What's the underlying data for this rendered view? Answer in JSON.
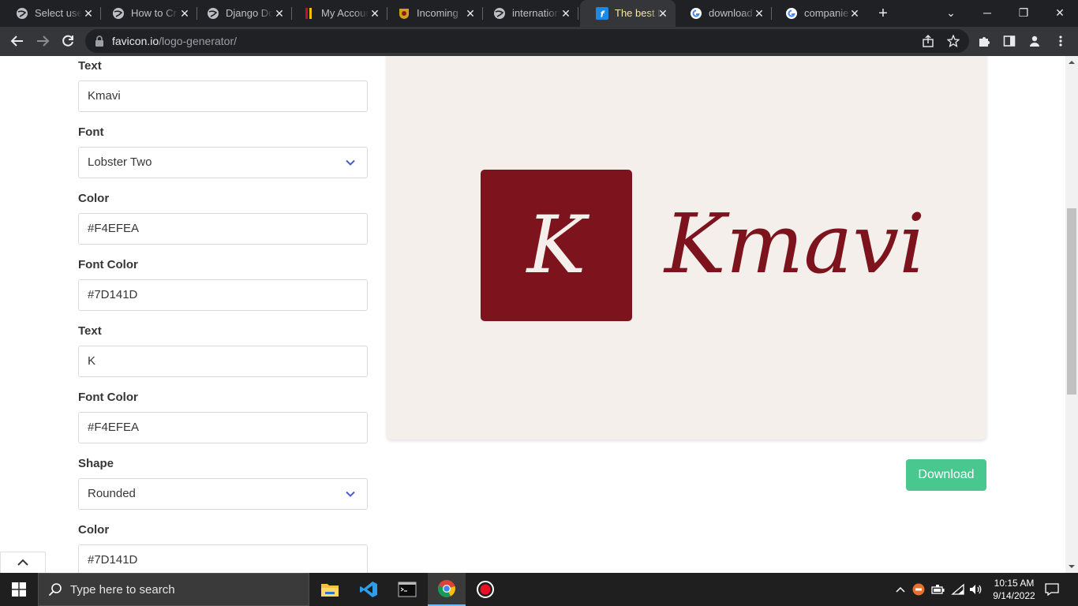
{
  "browser": {
    "tabs": [
      {
        "title": "Select user",
        "icon": "globe-icon"
      },
      {
        "title": "How to Cr",
        "icon": "globe-icon"
      },
      {
        "title": "Django Do",
        "icon": "globe-icon"
      },
      {
        "title": "My Accoun",
        "icon": "bank-icon"
      },
      {
        "title": "Incoming",
        "icon": "crest-icon"
      },
      {
        "title": "internation",
        "icon": "globe-icon"
      },
      {
        "title": "The best L",
        "icon": "favicon-f-icon",
        "active": true
      },
      {
        "title": "download",
        "icon": "google-icon"
      },
      {
        "title": "companie",
        "icon": "google-icon"
      }
    ],
    "url_host": "favicon.io",
    "url_path": "/logo-generator/"
  },
  "form": {
    "text_label": "Text",
    "text_value": "Kmavi",
    "font_label": "Font",
    "font_value": "Lobster Two",
    "color_label": "Color",
    "color_value": "#F4EFEA",
    "font_color_label": "Font Color",
    "font_color_value": "#7D141D",
    "initial_label": "Text",
    "initial_value": "K",
    "initial_color_label": "Font Color",
    "initial_color_value": "#F4EFEA",
    "shape_label": "Shape",
    "shape_value": "Rounded",
    "shape_color_label": "Color",
    "shape_color_value": "#7D141D"
  },
  "preview": {
    "initial": "K",
    "text": "Kmavi",
    "background_color": "#F4EFEA",
    "font_color": "#7D141D",
    "shape_color": "#7D141D"
  },
  "download_label": "Download",
  "taskbar": {
    "search_placeholder": "Type here to search",
    "time": "10:15 AM",
    "date": "9/14/2022"
  }
}
